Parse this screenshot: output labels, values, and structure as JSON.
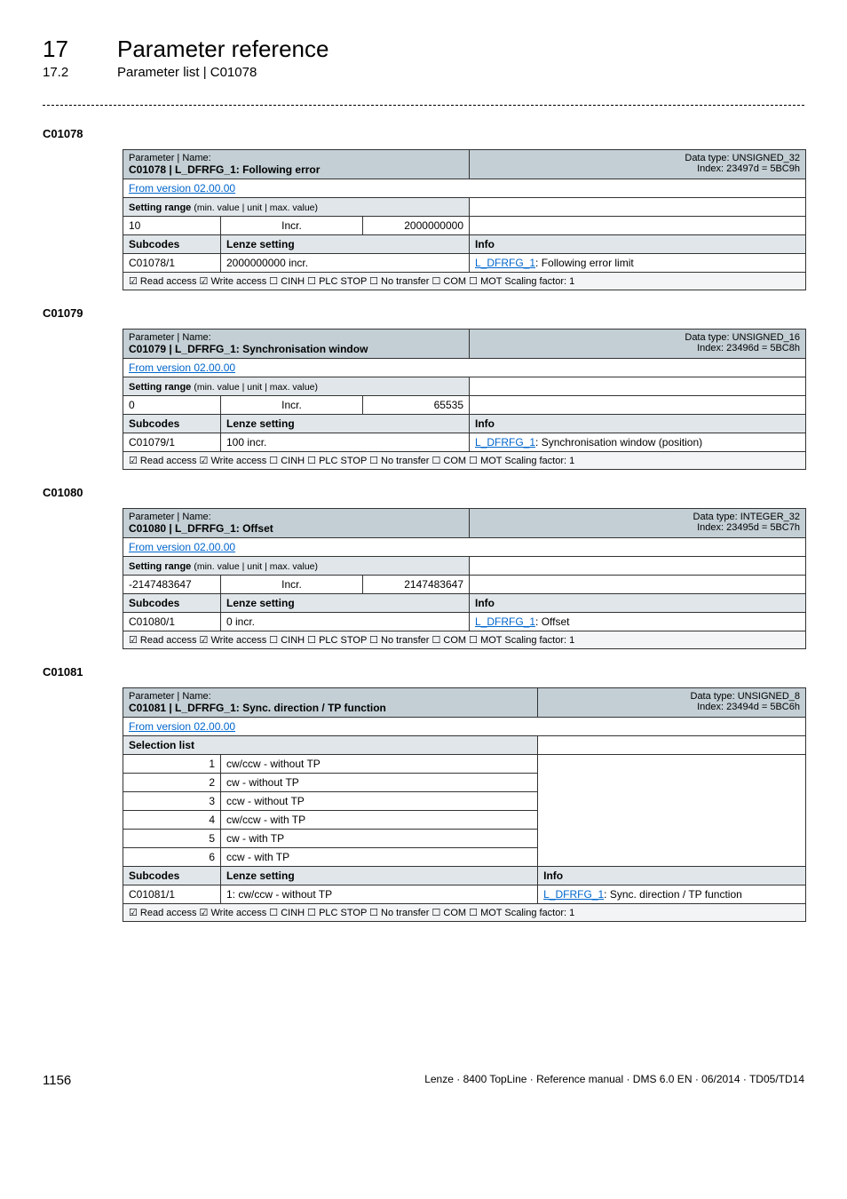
{
  "header": {
    "chapter_num": "17",
    "chapter_title": "Parameter reference",
    "section_num": "17.2",
    "section_title": "Parameter list | C01078"
  },
  "blocks": [
    {
      "id": "C01078",
      "name_label": "Parameter | Name:",
      "name_value": "C01078 | L_DFRFG_1: Following error",
      "data_type_l1": "Data type: UNSIGNED_32",
      "data_type_l2": "Index: 23497d = 5BC9h",
      "from_version": "From version 02.00.00",
      "setting_range_label": "Setting range (min. value | unit | max. value)",
      "range_min": "10",
      "range_unit": "Incr.",
      "range_max": "2000000000",
      "sub_h1": "Subcodes",
      "sub_h2": "Lenze setting",
      "sub_h3": "Info",
      "sub_code": "C01078/1",
      "sub_setting": "2000000000 incr.",
      "sub_info_link": "L_DFRFG_1",
      "sub_info_rest": ": Following error limit",
      "footer": "☑ Read access   ☑ Write access   ☐ CINH   ☐ PLC STOP   ☐ No transfer   ☐ COM   ☐ MOT    Scaling factor: 1"
    },
    {
      "id": "C01079",
      "name_label": "Parameter | Name:",
      "name_value": "C01079 | L_DFRFG_1: Synchronisation window",
      "data_type_l1": "Data type: UNSIGNED_16",
      "data_type_l2": "Index: 23496d = 5BC8h",
      "from_version": "From version 02.00.00",
      "setting_range_label": "Setting range (min. value | unit | max. value)",
      "range_min": "0",
      "range_unit": "Incr.",
      "range_max": "65535",
      "sub_h1": "Subcodes",
      "sub_h2": "Lenze setting",
      "sub_h3": "Info",
      "sub_code": "C01079/1",
      "sub_setting": "100 incr.",
      "sub_info_link": "L_DFRFG_1",
      "sub_info_rest": ": Synchronisation window (position)",
      "footer": "☑ Read access   ☑ Write access   ☐ CINH   ☐ PLC STOP   ☐ No transfer   ☐ COM   ☐ MOT    Scaling factor: 1"
    },
    {
      "id": "C01080",
      "name_label": "Parameter | Name:",
      "name_value": "C01080 | L_DFRFG_1: Offset",
      "data_type_l1": "Data type: INTEGER_32",
      "data_type_l2": "Index: 23495d = 5BC7h",
      "from_version": "From version 02.00.00",
      "setting_range_label": "Setting range (min. value | unit | max. value)",
      "range_min": "-2147483647",
      "range_unit": "Incr.",
      "range_max": "2147483647",
      "sub_h1": "Subcodes",
      "sub_h2": "Lenze setting",
      "sub_h3": "Info",
      "sub_code": "C01080/1",
      "sub_setting": "0 incr.",
      "sub_info_link": "L_DFRFG_1",
      "sub_info_rest": ": Offset",
      "footer": "☑ Read access   ☑ Write access   ☐ CINH   ☐ PLC STOP   ☐ No transfer   ☐ COM   ☐ MOT    Scaling factor: 1"
    },
    {
      "id": "C01081",
      "name_label": "Parameter | Name:",
      "name_value": "C01081 | L_DFRFG_1: Sync. direction / TP function",
      "data_type_l1": "Data type: UNSIGNED_8",
      "data_type_l2": "Index: 23494d = 5BC6h",
      "from_version": "From version 02.00.00",
      "selection_label": "Selection list",
      "selection": [
        {
          "n": "1",
          "t": "cw/ccw - without TP"
        },
        {
          "n": "2",
          "t": "cw - without TP"
        },
        {
          "n": "3",
          "t": "ccw - without TP"
        },
        {
          "n": "4",
          "t": "cw/ccw - with TP"
        },
        {
          "n": "5",
          "t": "cw - with TP"
        },
        {
          "n": "6",
          "t": "ccw - with TP"
        }
      ],
      "sub_h1": "Subcodes",
      "sub_h2": "Lenze setting",
      "sub_h3": "Info",
      "sub_code": "C01081/1",
      "sub_setting": "1: cw/ccw - without TP",
      "sub_info_link": "L_DFRFG_1",
      "sub_info_rest": ": Sync. direction / TP function",
      "footer": "☑ Read access   ☑ Write access   ☐ CINH   ☐ PLC STOP   ☐ No transfer   ☐ COM   ☐ MOT    Scaling factor: 1"
    }
  ],
  "footer": {
    "page": "1156",
    "doc": "Lenze · 8400 TopLine · Reference manual · DMS 6.0 EN · 06/2014 · TD05/TD14"
  }
}
